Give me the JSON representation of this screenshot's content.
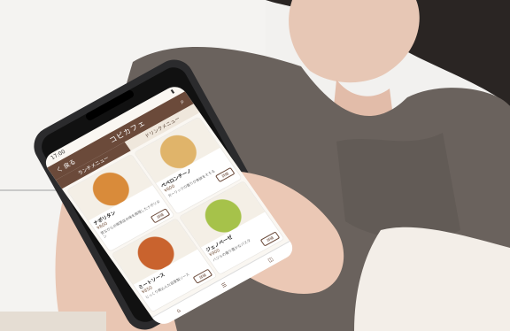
{
  "scene": {
    "colors": {
      "background": "#f2f1ef",
      "sweater": "#6a625d",
      "skin": "#e9c6b3",
      "nail": "#9fb3b8",
      "phone_frame": "#2b2b2d",
      "app_brand": "#6b4a3a"
    }
  },
  "app": {
    "status_time": "17:00",
    "header": {
      "back_label": "く 戻る",
      "title": "コピカフェ",
      "search_icon": "search-icon"
    },
    "tabs": [
      {
        "label": "ランチメニュー",
        "active": true
      },
      {
        "label": "ドリンクメニュー",
        "active": false
      }
    ],
    "items": [
      {
        "name": "ナポリタン",
        "price": "¥800",
        "desc": "昔ながらの喫茶店の味を再現したナポリタン",
        "more": "詳細",
        "img_color": "#d98b3a"
      },
      {
        "name": "ペペロンチーノ",
        "price": "¥800",
        "desc": "ガーリックの香りが食欲をそそる",
        "more": "詳細",
        "img_color": "#e0b46a"
      },
      {
        "name": "ミートソース",
        "price": "¥850",
        "desc": "じっくり煮込んだ自家製ソース",
        "more": "詳細",
        "img_color": "#c9632e"
      },
      {
        "name": "ジェノベーゼ",
        "price": "¥900",
        "desc": "バジルの香り豊かなパスタ",
        "more": "詳細",
        "img_color": "#a6c24a"
      }
    ],
    "bottom_nav": [
      {
        "icon": "home-icon",
        "glyph": "⌂"
      },
      {
        "icon": "menu-icon",
        "glyph": "☰"
      },
      {
        "icon": "cart-icon",
        "glyph": "◫"
      }
    ]
  }
}
